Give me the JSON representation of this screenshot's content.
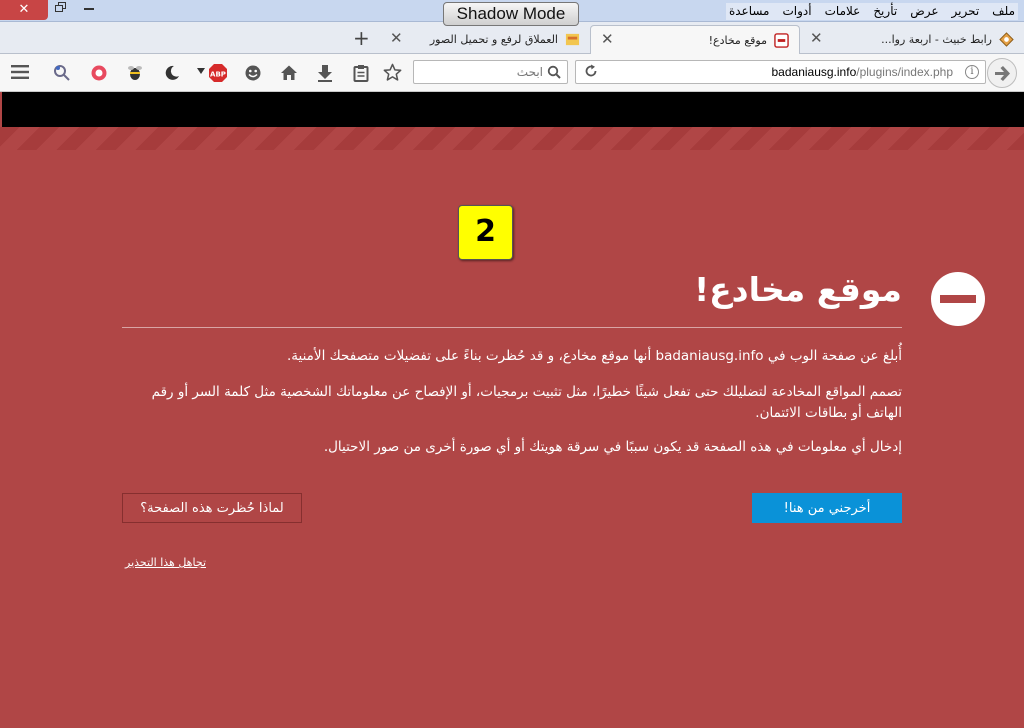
{
  "titlebar": {
    "close_glyph": "✕",
    "shadow_mode_label": "Shadow Mode",
    "menu": [
      "ملف",
      "تحرير",
      "عرض",
      "تأريخ",
      "علامات",
      "أدوات",
      "مساعدة"
    ]
  },
  "tabs": [
    {
      "title": "رابط خبيث - اربعة روا...",
      "icon": "site-favicon"
    },
    {
      "title": "موقع مخادع!",
      "icon": "warning-favicon",
      "active": true
    },
    {
      "title": "العملاق لرفع و تحميل الصور",
      "icon": "image-host-favicon"
    }
  ],
  "tab_close_glyph": "✕",
  "new_tab_glyph": "+",
  "navbar": {
    "search_placeholder": "ابحث",
    "url_host": "badaniausg.info",
    "url_path": "/plugins/index.php",
    "info_glyph": "i",
    "abp_label": "ABP"
  },
  "page": {
    "badge_number": "2",
    "heading": "موقع مخادع!",
    "paragraph_1": "أُبلغ عن صفحة الوب في badaniausg.info أنها موقع مخادع، و قد حُظرت بناءً على تفضيلات متصفحك الأمنية.",
    "paragraph_2": "تصمم المواقع المخادعة لتضليلك حتى تفعل شيئًا خطيرًا، مثل تثبيت برمجيات، أو الإفصاح عن معلوماتك الشخصية مثل كلمة السر أو رقم الهاتف أو بطاقات الائتمان.",
    "paragraph_3": "إدخال أي معلومات في هذه الصفحة قد يكون سببًا في سرقة هويتك أو أي صورة أخرى من صور الاحتيال.",
    "leave_button": "أخرجني من هنا!",
    "why_button": "لماذا حُظرت هذه الصفحة؟",
    "ignore_link": "تجاهل هذا التحذير"
  },
  "colors": {
    "page_background": "#b04646",
    "leave_button": "#0a92d8",
    "badge": "#ffff00"
  }
}
